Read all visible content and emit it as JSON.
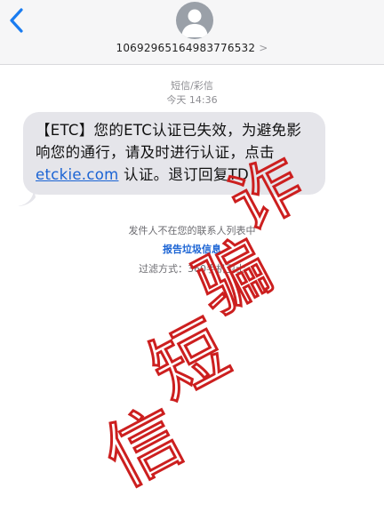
{
  "header": {
    "back_icon": "chevron-left-icon",
    "avatar_icon": "person-silhouette-icon",
    "sender_number": "1069296516498377653",
    "sender_suffix": "2",
    "chevron": ">"
  },
  "thread": {
    "message_type": "短信/彩信",
    "timestamp": "今天 14:36"
  },
  "message": {
    "text_before_link": "【ETC】您的ETC认证已失效，为避免影响您的通行，请及时进行认证，点击",
    "link_text": "etckie.com",
    "text_after_link": "认证。退订回复TD"
  },
  "notices": {
    "not_in_contacts": "发件人不在您的联系人列表中",
    "report_junk": "报告垃圾信息",
    "filter_method": "过滤方式：360手机卫士"
  },
  "overlay": {
    "stamp_text": "诈骗短信",
    "stamp_color": "#cc1f1f"
  },
  "colors": {
    "accent": "#1a63d4",
    "bubble": "#e5e5ea",
    "header_bg": "#f6f6f7"
  }
}
